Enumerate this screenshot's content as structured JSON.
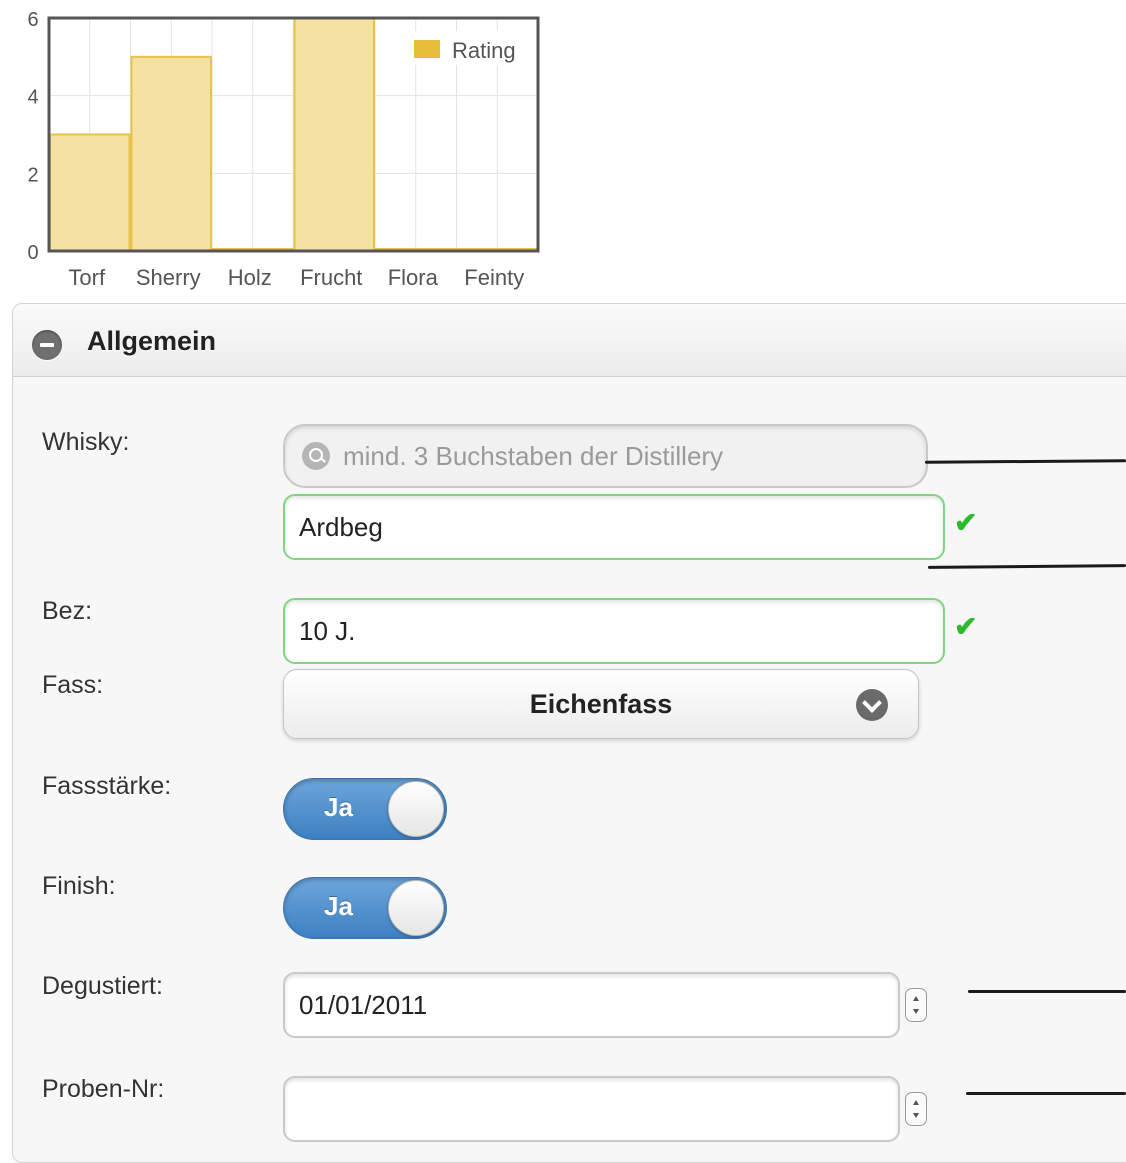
{
  "chart_data": {
    "type": "bar",
    "categories": [
      "Torf",
      "Sherry",
      "Holz",
      "Frucht",
      "Flora",
      "Feinty"
    ],
    "series": [
      {
        "name": "Rating",
        "values": [
          3,
          5,
          0,
          6,
          0,
          0
        ]
      }
    ],
    "yticks": [
      "0",
      "2",
      "4",
      "6"
    ],
    "ylim": [
      0,
      6
    ],
    "grid": true,
    "legend_position": "top-right",
    "bar_fill": "#f5e1a4",
    "bar_stroke": "#e9c24b",
    "legend_color": "#e8bd3a"
  },
  "panel": {
    "title": "Allgemein"
  },
  "form": {
    "whisky": {
      "label": "Whisky:",
      "search_placeholder": "mind. 3 Buchstaben der Distillery",
      "value": "Ardbeg"
    },
    "bez": {
      "label": "Bez:",
      "value": "10 J."
    },
    "fass": {
      "label": "Fass:",
      "selected": "Eichenfass"
    },
    "fassstaerke": {
      "label": "Fassstärke:",
      "toggle": "Ja"
    },
    "finish": {
      "label": "Finish:",
      "toggle": "Ja"
    },
    "degustiert": {
      "label": "Degustiert:",
      "value": "01/01/2011"
    },
    "proben_nr": {
      "label": "Proben-Nr:",
      "value": ""
    }
  },
  "icons": {
    "valid": "checkmark-icon",
    "check_glyph": "✔"
  },
  "colors": {
    "valid_border": "#7fd67f",
    "valid_check": "#2dbb2d",
    "toggle_on": "#4a8bca"
  }
}
